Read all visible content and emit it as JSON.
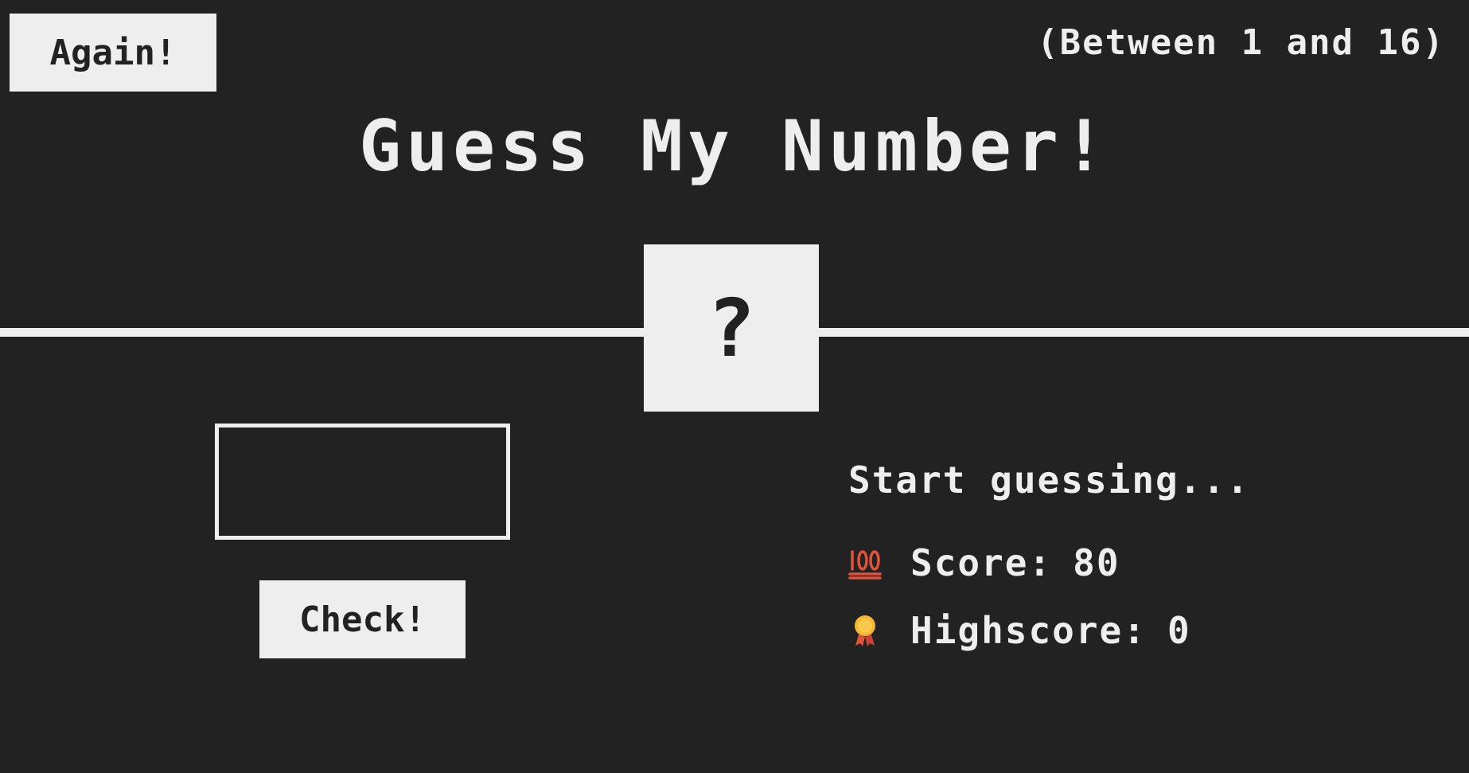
{
  "header": {
    "again_label": "Again!",
    "range_text": "(Between 1 and 16)"
  },
  "title": "Guess My Number!",
  "secret_number": "?",
  "guess": {
    "value": "",
    "placeholder": ""
  },
  "check_label": "Check!",
  "message": "Start guessing...",
  "stats": {
    "score_icon": "hundred-points-icon",
    "score_label": "Score:",
    "score_value": "80",
    "highscore_icon": "medal-icon",
    "highscore_label": "Highscore:",
    "highscore_value": "0"
  },
  "colors": {
    "background": "#222222",
    "foreground": "#eeeeee",
    "score_icon": "#e0523a",
    "medal_gold": "#f5b731",
    "medal_ribbon": "#e0523a"
  }
}
